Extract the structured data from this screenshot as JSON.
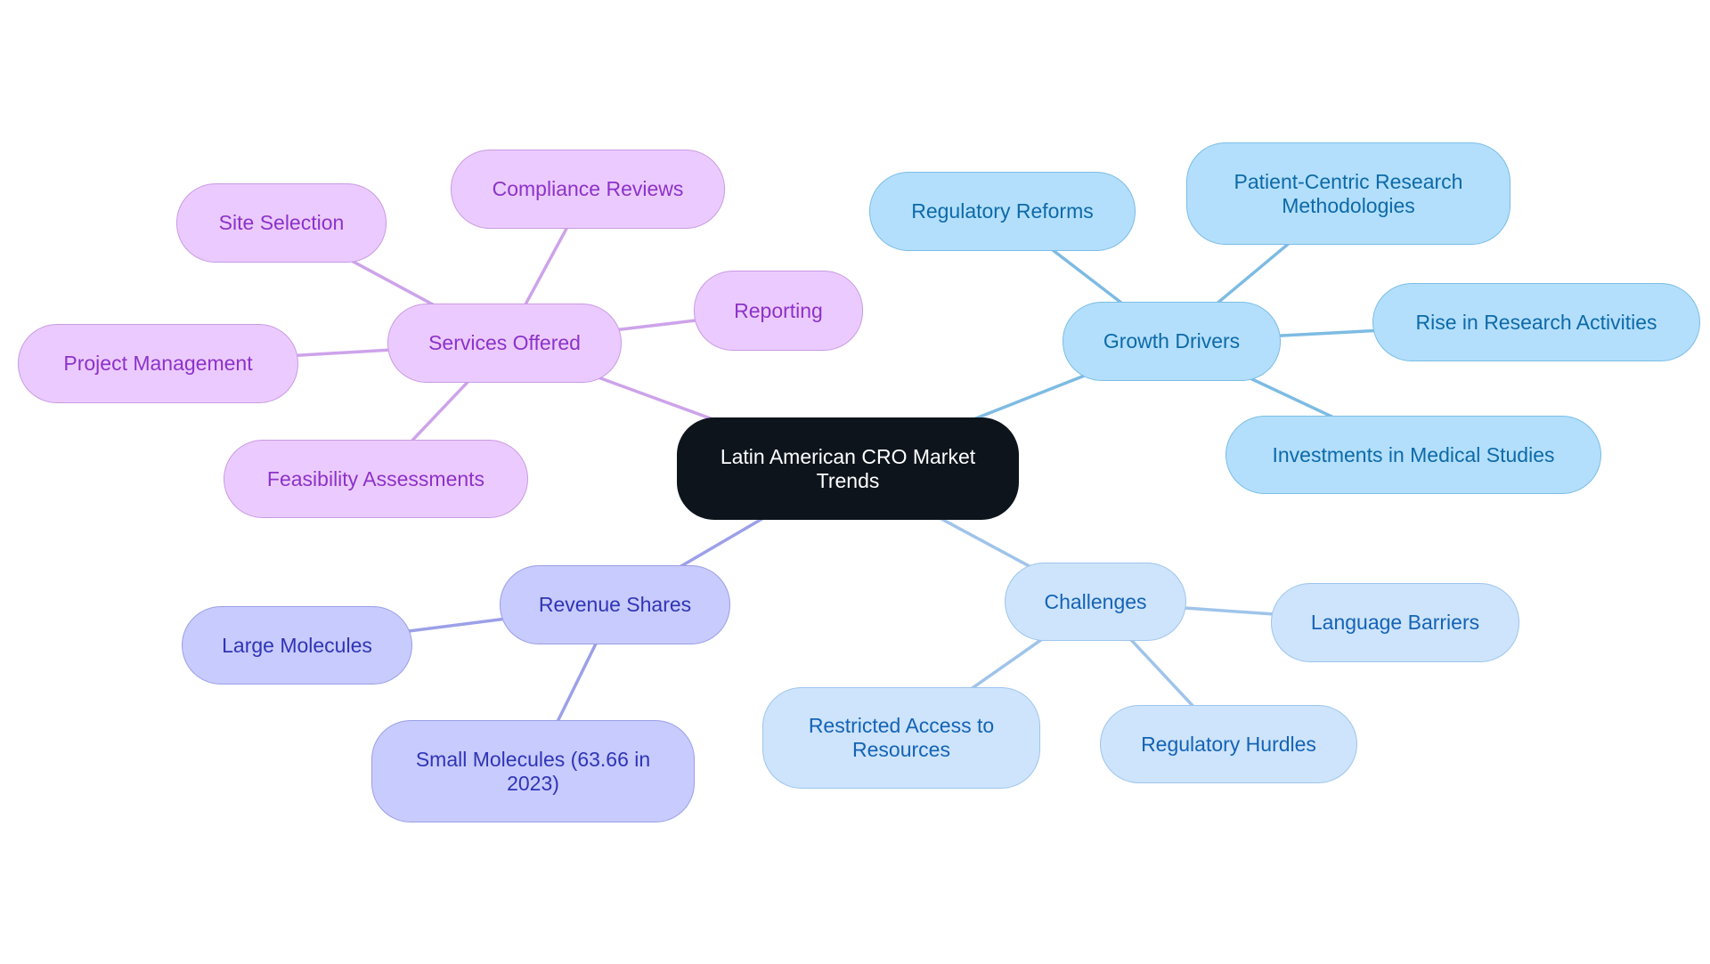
{
  "diagram": {
    "type": "mindmap",
    "title": "Latin American CRO Market Trends",
    "root": {
      "id": "root",
      "label": "Latin American CRO Market Trends",
      "style": {
        "fill": "#0d141c",
        "border": "#0d141c",
        "text": "#ffffff"
      }
    },
    "branches": [
      {
        "id": "services",
        "label": "Services Offered",
        "style": {
          "fill": "#ebcbff",
          "border": "#c99ae3",
          "text": "#8d32c9",
          "edge": "#cda3ea"
        },
        "children": [
          {
            "id": "compliance",
            "label": "Compliance Reviews"
          },
          {
            "id": "site",
            "label": "Site Selection"
          },
          {
            "id": "reporting",
            "label": "Reporting"
          },
          {
            "id": "project",
            "label": "Project Management"
          },
          {
            "id": "feasibility",
            "label": "Feasibility Assessments"
          }
        ]
      },
      {
        "id": "growth",
        "label": "Growth Drivers",
        "style": {
          "fill": "#b3dffc",
          "border": "#7bbde6",
          "text": "#0d6aa8",
          "edge": "#7dbbe3"
        },
        "children": [
          {
            "id": "regreforms",
            "label": "Regulatory Reforms"
          },
          {
            "id": "patient",
            "label": "Patient-Centric Research Methodologies"
          },
          {
            "id": "rise",
            "label": "Rise in Research Activities"
          },
          {
            "id": "investments",
            "label": "Investments in Medical Studies"
          }
        ]
      },
      {
        "id": "challenges",
        "label": "Challenges",
        "style": {
          "fill": "#cde4fc",
          "border": "#9ec5ec",
          "text": "#1463b5",
          "edge": "#9fc4ea"
        },
        "children": [
          {
            "id": "language",
            "label": "Language Barriers"
          },
          {
            "id": "hurdles",
            "label": "Regulatory Hurdles"
          },
          {
            "id": "restricted",
            "label": "Restricted Access to Resources"
          }
        ]
      },
      {
        "id": "revenue",
        "label": "Revenue Shares",
        "style": {
          "fill": "#c8cbfd",
          "border": "#9a9fe8",
          "text": "#2f35b5",
          "edge": "#9ca0e8"
        },
        "children": [
          {
            "id": "large",
            "label": "Large Molecules"
          },
          {
            "id": "small",
            "label": "Small Molecules (63.66 in 2023)"
          }
        ]
      }
    ]
  }
}
